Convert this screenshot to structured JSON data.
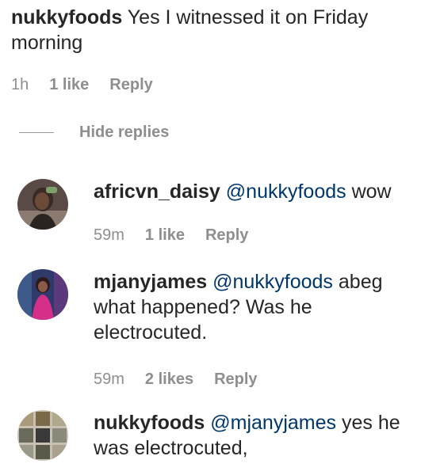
{
  "top_comment": {
    "username": "nukkyfoods",
    "text": "Yes I witnessed it on Friday morning",
    "time": "1h",
    "likes": "1 like",
    "reply": "Reply"
  },
  "hide_replies_label": "Hide replies",
  "replies": [
    {
      "username": "africvn_daisy",
      "mention": "@nukkyfoods",
      "text": "wow",
      "time": "59m",
      "likes": "1 like",
      "reply": "Reply",
      "avatar_icon": "profile-photo-woman"
    },
    {
      "username": "mjanyjames",
      "mention": "@nukkyfoods",
      "text": "abeg what happened? Was he electrocuted.",
      "time": "59m",
      "likes": "2 likes",
      "reply": "Reply",
      "avatar_icon": "profile-photo-woman-pink"
    },
    {
      "username": "nukkyfoods",
      "mention": "@mjanyjames",
      "text": "yes he was electrocuted,",
      "avatar_icon": "profile-photo-food-grid"
    }
  ],
  "colors": {
    "text": "#262626",
    "meta": "#8e8e8e",
    "mention": "#00376b"
  }
}
